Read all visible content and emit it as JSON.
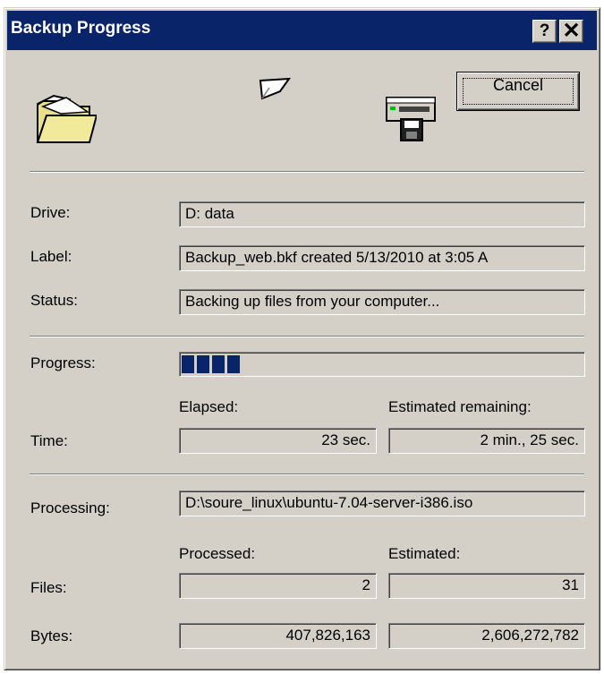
{
  "window": {
    "title": "Backup Progress",
    "help_label": "?",
    "close_label": "✕"
  },
  "icons": {
    "source": "folder-icon",
    "transfer": "flying-page-icon",
    "destination": "tape-drive-icon"
  },
  "buttons": {
    "cancel_label": "Cancel"
  },
  "details": {
    "drive_label": "Drive:",
    "drive_value": "D: data",
    "label_label": "Label:",
    "label_value": "Backup_web.bkf created 5/13/2010 at 3:05 A",
    "status_label": "Status:",
    "status_value": "Backing up files from your computer..."
  },
  "progress": {
    "label": "Progress:",
    "fraction": 0.17,
    "color": "#0a246a"
  },
  "time": {
    "label": "Time:",
    "elapsed_header": "Elapsed:",
    "remaining_header": "Estimated remaining:",
    "elapsed_value": "23 sec.",
    "remaining_value": "2 min., 25 sec."
  },
  "processing": {
    "label": "Processing:",
    "value": "D:\\soure_linux\\ubuntu-7.04-server-i386.iso"
  },
  "counts": {
    "processed_header": "Processed:",
    "estimated_header": "Estimated:",
    "files_label": "Files:",
    "files_processed": "2",
    "files_estimated": "31",
    "bytes_label": "Bytes:",
    "bytes_processed": "407,826,163",
    "bytes_estimated": "2,606,272,782"
  }
}
